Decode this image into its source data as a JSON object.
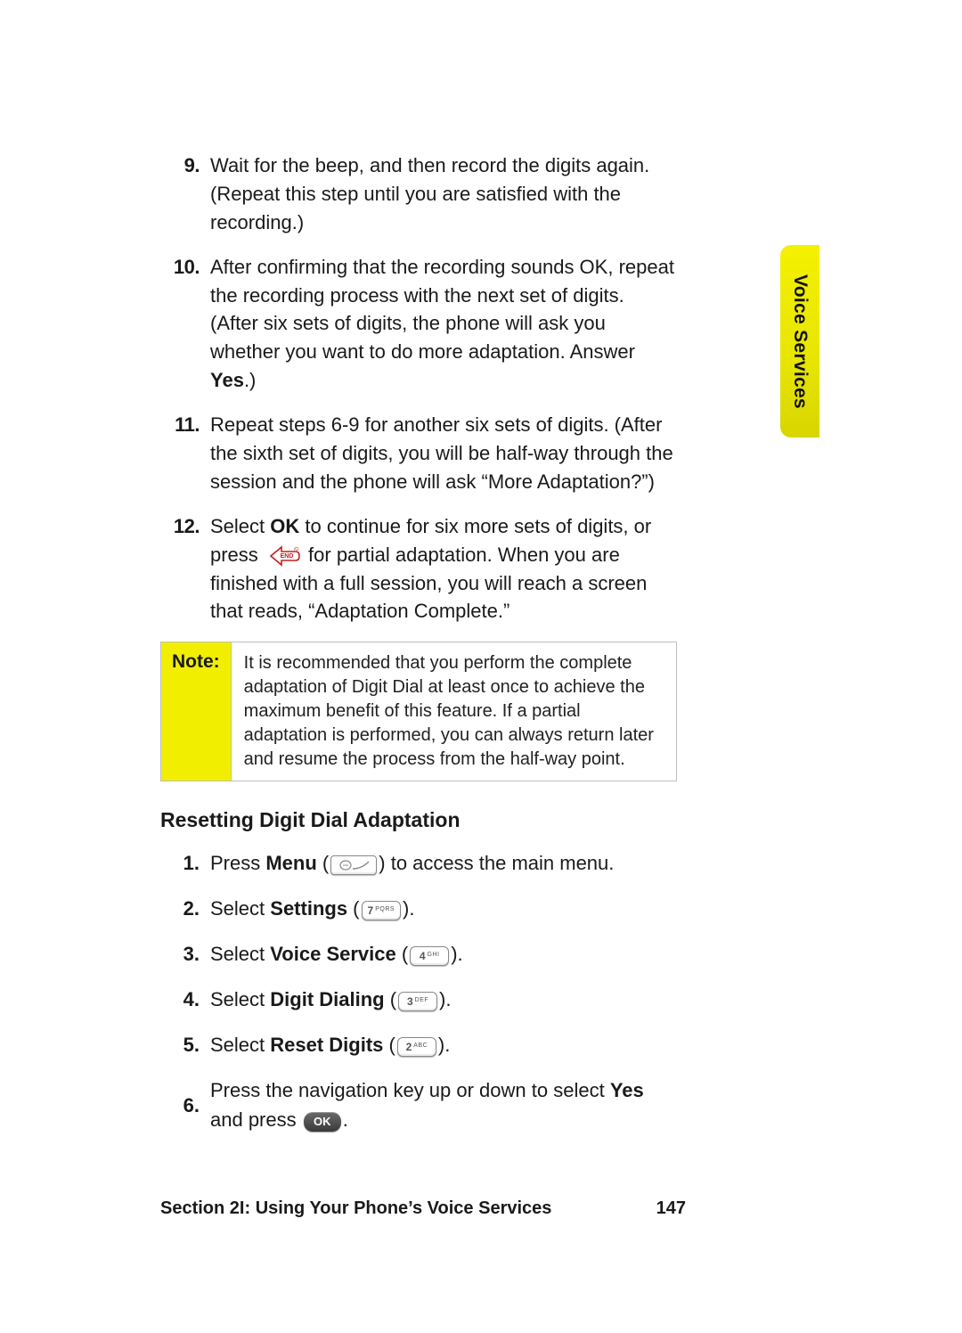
{
  "tab_label": "Voice Services",
  "upper_steps": [
    {
      "num": "9.",
      "parts": [
        {
          "t": "Wait for the beep, and then record the digits again. (Repeat this step until you are satisfied with the recording.)"
        }
      ]
    },
    {
      "num": "10.",
      "parts": [
        {
          "t": "After confirming that the recording sounds OK, repeat the recording process with the next set of digits. (After six sets of digits, the phone will ask you whether you want to do more adaptation. Answer "
        },
        {
          "t": "Yes",
          "b": true
        },
        {
          "t": ".)"
        }
      ]
    },
    {
      "num": "11.",
      "parts": [
        {
          "t": "Repeat steps 6-9 for another six sets of digits. (After the sixth set of digits, you will be half-way through the session and the phone will ask “More Adaptation?”)"
        }
      ]
    },
    {
      "num": "12.",
      "parts": [
        {
          "t": "Select "
        },
        {
          "t": "OK",
          "b": true
        },
        {
          "t": " to continue for six more sets of digits, or press "
        },
        {
          "icon": "end-key"
        },
        {
          "t": " for partial adaptation. When you are finished with a full session, you will reach a screen that reads, “Adaptation Complete.”"
        }
      ]
    }
  ],
  "note": {
    "label": "Note:",
    "text": "It is recommended that you perform the complete adaptation of Digit Dial at least once to achieve the maximum benefit of this feature. If a partial adaptation is performed, you can always return later and resume the process from the half-way point."
  },
  "heading2": "Resetting Digit Dial Adaptation",
  "lower_steps": [
    {
      "num": "1.",
      "parts": [
        {
          "t": "Press "
        },
        {
          "t": "Menu",
          "b": true
        },
        {
          "t": " ("
        },
        {
          "icon": "softkey"
        },
        {
          "t": ") to access the main menu."
        }
      ]
    },
    {
      "num": "2.",
      "parts": [
        {
          "t": "Select "
        },
        {
          "t": "Settings",
          "b": true
        },
        {
          "t": " ("
        },
        {
          "icon": "key",
          "digit": "7",
          "letters": "PQRS"
        },
        {
          "t": ")."
        }
      ]
    },
    {
      "num": "3.",
      "parts": [
        {
          "t": "Select "
        },
        {
          "t": "Voice Service",
          "b": true
        },
        {
          "t": " ("
        },
        {
          "icon": "key",
          "digit": "4",
          "letters": "GHI"
        },
        {
          "t": ")."
        }
      ]
    },
    {
      "num": "4.",
      "parts": [
        {
          "t": "Select "
        },
        {
          "t": "Digit Dialing",
          "b": true
        },
        {
          "t": " ("
        },
        {
          "icon": "key",
          "digit": "3",
          "letters": "DEF"
        },
        {
          "t": ")."
        }
      ]
    },
    {
      "num": "5.",
      "parts": [
        {
          "t": "Select "
        },
        {
          "t": "Reset Digits",
          "b": true
        },
        {
          "t": " ("
        },
        {
          "icon": "key",
          "digit": "2",
          "letters": "ABC"
        },
        {
          "t": ")."
        }
      ]
    },
    {
      "num": "6.",
      "parts": [
        {
          "t": "Press the navigation key up or down to select "
        },
        {
          "t": "Yes",
          "b": true
        },
        {
          "t": " and press "
        },
        {
          "icon": "ok-key"
        },
        {
          "t": "."
        }
      ]
    }
  ],
  "footer": {
    "section": "Section 2I: Using Your Phone’s Voice Services",
    "page": "147"
  }
}
